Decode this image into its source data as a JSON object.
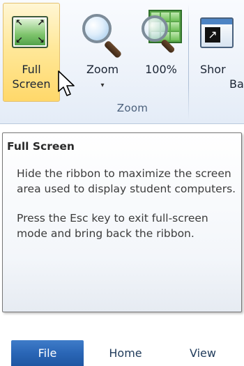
{
  "ribbon": {
    "group_label": "Zoom",
    "buttons": [
      {
        "id": "full-screen",
        "label_line1": "Full",
        "label_line2": "Screen",
        "icon": "full-screen-icon",
        "state": "hover"
      },
      {
        "id": "zoom",
        "label_line1": "Zoom",
        "dropdown": "▾",
        "icon": "zoom-icon"
      },
      {
        "id": "zoom-100",
        "label_line1": "100%",
        "icon": "zoom-100-icon"
      },
      {
        "id": "shortcut-bar",
        "label_line1": "Shor",
        "label_line2": "Ba",
        "icon": "shortcut-bar-icon"
      }
    ]
  },
  "tooltip": {
    "title": "Full Screen",
    "paragraphs": [
      "Hide the ribbon to maximize the screen area used to display student computers.",
      "Press the Esc key to exit full-screen mode and bring back the ribbon."
    ]
  },
  "tabs": [
    {
      "label": "File",
      "active": true
    },
    {
      "label": "Home",
      "active": false
    },
    {
      "label": "View",
      "active": false
    }
  ],
  "colors": {
    "file_tab": "#2a66b6",
    "hover_button": "#ffe89a",
    "ribbon_bg": "#eef3fa"
  }
}
